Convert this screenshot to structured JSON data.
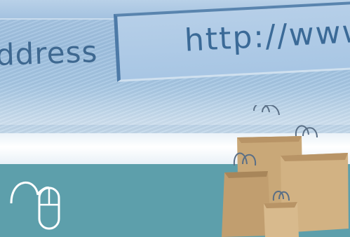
{
  "screen": {
    "menu_fragment": "",
    "address_label": "ddress",
    "address_value": "http://www."
  },
  "icons": {
    "mouse": "computer-mouse-with-cord-icon",
    "bags": "shopping-bags-illustration"
  },
  "colors": {
    "screen_blue": "#a9c6e2",
    "text_blue": "#3e6890",
    "band_white": "#ffffff",
    "teal": "#5d9fab",
    "bag_kraft": "#c9a878"
  }
}
